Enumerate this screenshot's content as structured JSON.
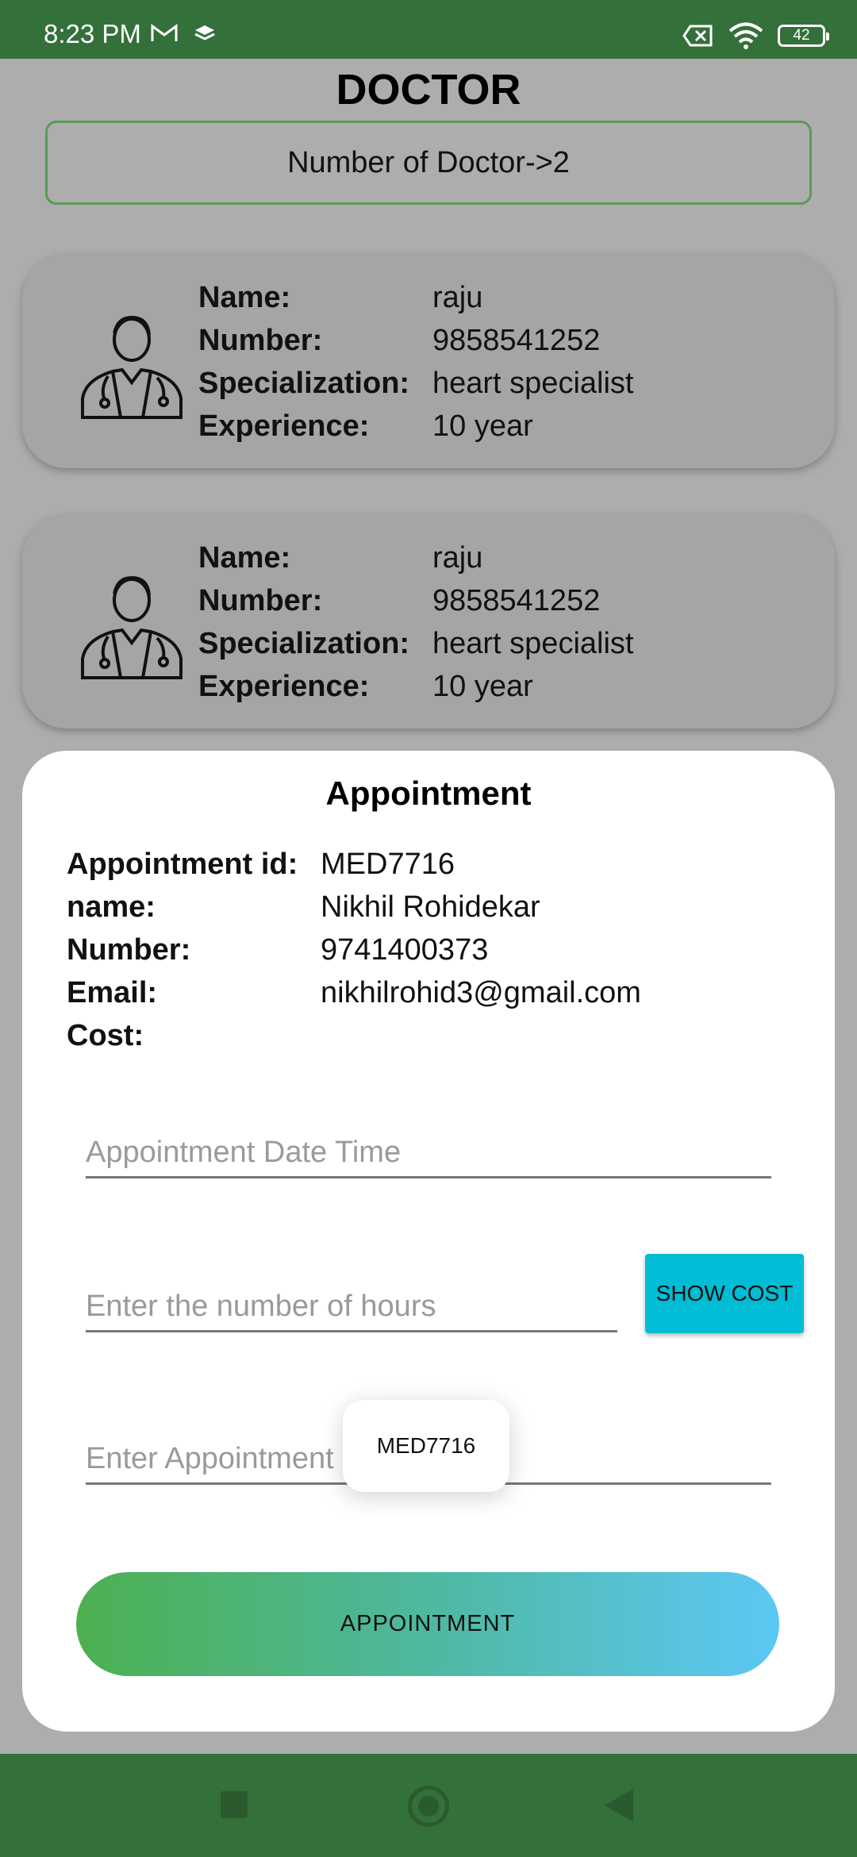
{
  "status_bar": {
    "time": "8:23 PM",
    "battery": "42",
    "icons": [
      "gmail-icon",
      "layers-icon",
      "no-sim-icon",
      "wifi-icon",
      "battery-icon"
    ]
  },
  "header": {
    "title": "DOCTOR",
    "doctor_count": "Number of Doctor->2"
  },
  "doctors": [
    {
      "name_label": "Name:",
      "name": "raju",
      "number_label": "Number:",
      "number": "9858541252",
      "specialization_label": "Specialization:",
      "specialization": "heart specialist",
      "experience_label": "Experience:",
      "experience": "10 year"
    },
    {
      "name_label": "Name:",
      "name": "raju",
      "number_label": "Number:",
      "number": "9858541252",
      "specialization_label": "Specialization:",
      "specialization": "heart specialist",
      "experience_label": "Experience:",
      "experience": "10 year"
    }
  ],
  "dialog": {
    "title": "Appointment",
    "id_label": "Appointment id:",
    "id_value": "MED7716",
    "name_label": "name:",
    "name_value": "Nikhil Rohidekar",
    "number_label": "Number:",
    "number_value": "9741400373",
    "email_label": "Email:",
    "email_value": "nikhilrohid3@gmail.com",
    "cost_label": "Cost:",
    "cost_value": "",
    "date_time_placeholder": "Appointment Date Time",
    "hours_placeholder": "Enter the number of hours",
    "show_cost_label": "SHOW COST",
    "appt_id_placeholder": "Enter Appointment Id",
    "toast_text": "MED7716",
    "appointment_button": "APPOINTMENT"
  },
  "colors": {
    "status_bar": "#34703a",
    "count_border": "#5a9a57",
    "show_cost": "#00bcd4",
    "gradient_start": "#4cb050",
    "gradient_end": "#5bc8f5"
  }
}
